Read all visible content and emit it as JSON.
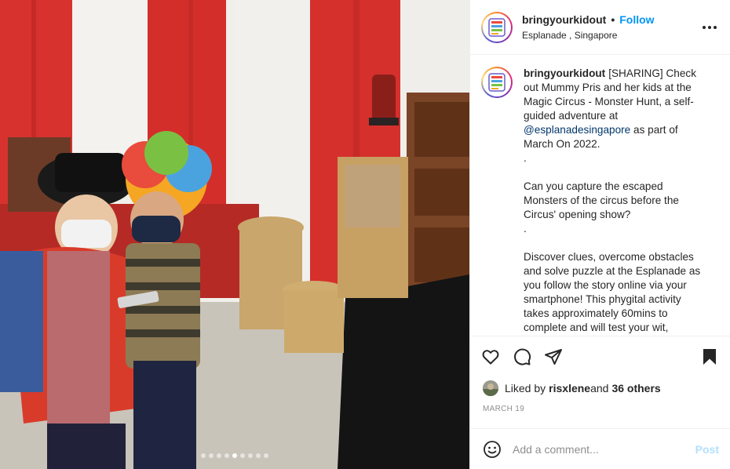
{
  "post": {
    "username": "bringyourkidout",
    "separator": "•",
    "follow_label": "Follow",
    "location": "Esplanade , Singapore",
    "more_icon": "more-horizontal-icon"
  },
  "photo": {
    "description_icon": "post-photo",
    "carousel": {
      "count": 9,
      "active_index": 4
    }
  },
  "caption": {
    "username": "bringyourkidout",
    "lines": [
      "[SHARING] Check out Mummy Pris and her kids at the Magic Circus - Monster Hunt, a self-guided adventure at ",
      "@esplanadesingapore",
      " as part of March On 2022.",
      ".",
      "Can you capture the escaped Monsters of the circus before the Circus' opening show?",
      ".",
      "Discover clues, overcome obstacles and solve puzzle at the Esplanade as you follow the story online via your smartphone! This phygital activity takes approximately 60mins to complete and will test your wit, courage and compassion!"
    ]
  },
  "actions": {
    "like_icon": "heart-icon",
    "comment_icon": "comment-icon",
    "share_icon": "share-icon",
    "save_icon": "bookmark-icon"
  },
  "likes": {
    "prefix": "Liked by",
    "user": "risxlene",
    "conj": "and",
    "others": "36 others"
  },
  "date": "MARCH 19",
  "comment": {
    "placeholder": "Add a comment...",
    "post_label": "Post",
    "emoji_icon": "emoji-icon"
  },
  "colors": {
    "link_blue": "#0095f6",
    "mention": "#00376b",
    "post_disabled": "#b2dffc",
    "muted": "#8e8e8e"
  }
}
